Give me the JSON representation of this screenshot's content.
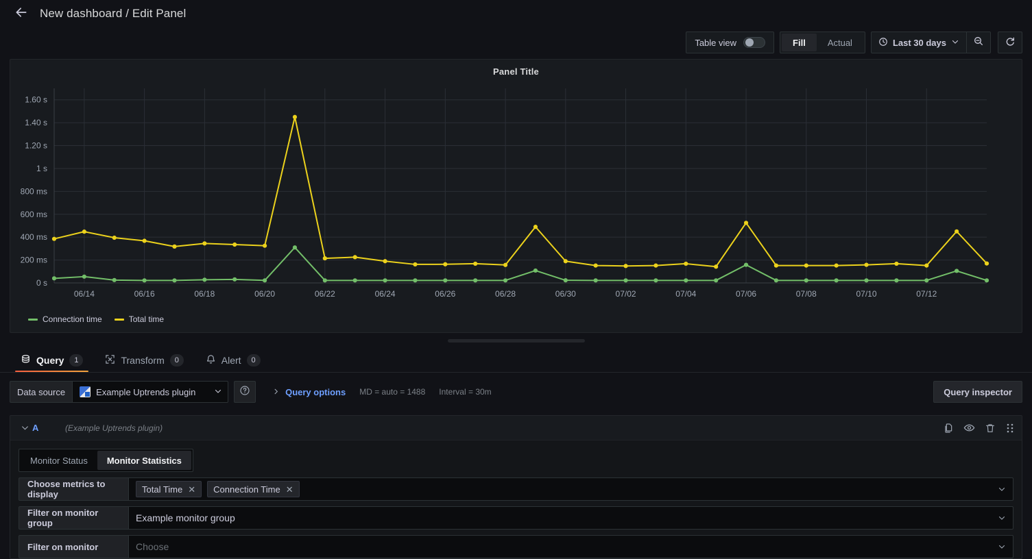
{
  "header": {
    "back_icon": "arrow-left-icon",
    "breadcrumb": "New dashboard / Edit Panel"
  },
  "toolbar": {
    "table_view_label": "Table view",
    "table_view_on": false,
    "fill_label": "Fill",
    "actual_label": "Actual",
    "active_sizing": "Fill",
    "time_range": "Last 30 days",
    "clock_icon": "clock-icon",
    "chevron_icon": "chevron-down-icon",
    "zoom_out_icon": "zoom-out-icon",
    "refresh_icon": "refresh-icon"
  },
  "panel": {
    "title": "Panel Title"
  },
  "chart_data": {
    "type": "line",
    "title": "Panel Title",
    "xlabel": "",
    "ylabel": "",
    "ylim": [
      0,
      1.7
    ],
    "grid": true,
    "legend_position": "bottom-left",
    "y_ticks": [
      "0 s",
      "200 ms",
      "400 ms",
      "600 ms",
      "800 ms",
      "1 s",
      "1.20 s",
      "1.40 s",
      "1.60 s"
    ],
    "y_tick_values": [
      0,
      0.2,
      0.4,
      0.6,
      0.8,
      1.0,
      1.2,
      1.4,
      1.6
    ],
    "x_ticks": [
      "06/14",
      "06/16",
      "06/18",
      "06/20",
      "06/22",
      "06/24",
      "06/26",
      "06/28",
      "06/30",
      "07/02",
      "07/04",
      "07/06",
      "07/08",
      "07/10",
      "07/12"
    ],
    "x": [
      "06/13",
      "06/14",
      "06/15",
      "06/16",
      "06/17",
      "06/18",
      "06/19",
      "06/20",
      "06/21",
      "06/22",
      "06/23",
      "06/24",
      "06/25",
      "06/26",
      "06/27",
      "06/28",
      "06/29",
      "06/30",
      "07/01",
      "07/02",
      "07/03",
      "07/04",
      "07/05",
      "07/06",
      "07/07",
      "07/08",
      "07/09",
      "07/10",
      "07/11",
      "07/12",
      "07/13"
    ],
    "series": [
      {
        "name": "Total time",
        "color": "#ecd21c",
        "unit": "s",
        "values": [
          0.385,
          0.448,
          0.395,
          0.368,
          0.318,
          0.345,
          0.335,
          0.325,
          1.45,
          0.215,
          0.225,
          0.19,
          0.162,
          0.163,
          0.168,
          0.157,
          0.49,
          0.19,
          0.152,
          0.148,
          0.152,
          0.168,
          0.142,
          0.525,
          0.152,
          0.152,
          0.152,
          0.158,
          0.168,
          0.152,
          0.45,
          0.17
        ]
      },
      {
        "name": "Connection time",
        "color": "#73bf69",
        "unit": "s",
        "values": [
          0.04,
          0.055,
          0.025,
          0.022,
          0.022,
          0.028,
          0.031,
          0.022,
          0.31,
          0.022,
          0.022,
          0.022,
          0.022,
          0.022,
          0.022,
          0.022,
          0.108,
          0.023,
          0.022,
          0.022,
          0.022,
          0.022,
          0.022,
          0.158,
          0.022,
          0.022,
          0.022,
          0.022,
          0.022,
          0.022,
          0.105,
          0.022
        ]
      }
    ],
    "legend": [
      {
        "label": "Connection time",
        "color": "#73bf69"
      },
      {
        "label": "Total time",
        "color": "#ecd21c"
      }
    ]
  },
  "tabs": [
    {
      "label": "Query",
      "badge": "1",
      "icon": "database-icon",
      "active": true
    },
    {
      "label": "Transform",
      "badge": "0",
      "icon": "transform-icon",
      "active": false
    },
    {
      "label": "Alert",
      "badge": "0",
      "icon": "bell-icon",
      "active": false
    }
  ],
  "query_bar": {
    "data_source_label": "Data source",
    "data_source_value": "Example Uptrends plugin",
    "data_source_logo": "uptrends-logo-icon",
    "help_icon": "help-circle-icon",
    "query_options_label": "Query options",
    "max_data_points": "MD = auto = 1488",
    "interval": "Interval = 30m",
    "query_inspector_label": "Query inspector"
  },
  "query_row": {
    "ref_id": "A",
    "data_source_note": "(Example Uptrends plugin)",
    "collapse_icon": "chevron-down-icon",
    "actions": [
      {
        "name": "duplicate-query-icon",
        "title": "copy-icon"
      },
      {
        "name": "toggle-visibility-icon",
        "title": "eye-icon"
      },
      {
        "name": "remove-query-icon",
        "title": "trash-icon"
      },
      {
        "name": "drag-handle-icon",
        "title": "grip-icon"
      }
    ],
    "mode_tabs": [
      {
        "label": "Monitor Status",
        "active": false
      },
      {
        "label": "Monitor Statistics",
        "active": true
      }
    ],
    "fields": [
      {
        "label": "Choose metrics to display",
        "type": "multiselect",
        "chips": [
          "Total Time",
          "Connection Time"
        ],
        "remove_icon": "close-icon"
      },
      {
        "label": "Filter on monitor group",
        "type": "select",
        "value": "Example monitor group",
        "placeholder": ""
      },
      {
        "label": "Filter on monitor",
        "type": "select",
        "value": "",
        "placeholder": "Choose"
      }
    ]
  }
}
